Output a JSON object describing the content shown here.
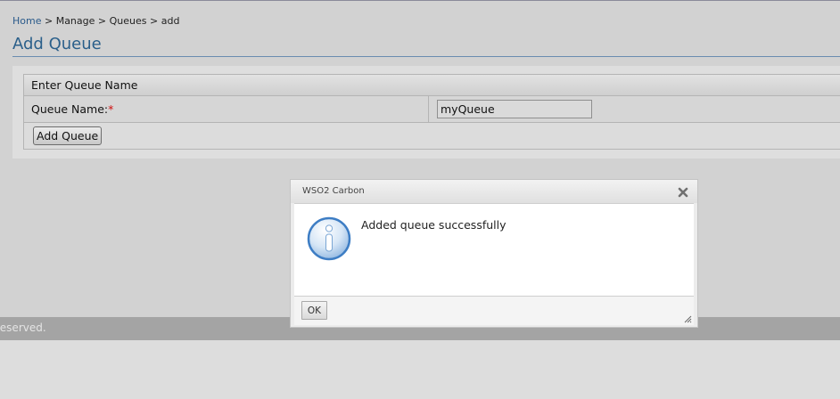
{
  "breadcrumb": {
    "home": "Home",
    "sep": ">",
    "manage": "Manage",
    "queues": "Queues",
    "current": "add"
  },
  "page": {
    "title": "Add Queue"
  },
  "form": {
    "header": "Enter Queue Name",
    "queue_name_label": "Queue Name:",
    "required_mark": "*",
    "queue_name_value": "myQueue",
    "submit_label": "Add Queue"
  },
  "footer": {
    "text": "Reserved."
  },
  "dialog": {
    "title": "WSO2 Carbon",
    "message": "Added queue successfully",
    "ok_label": "OK",
    "icon": "info-icon",
    "close_icon": "close-icon"
  },
  "colors": {
    "link": "#2a5a8a",
    "title": "#2a5f8a",
    "required": "#d01010",
    "footer_bar": "#a4a4a4",
    "info_icon": "#3d7dc4"
  }
}
